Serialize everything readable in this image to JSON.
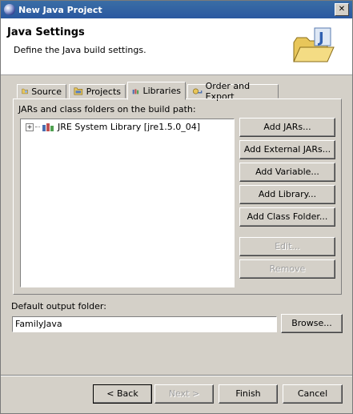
{
  "window": {
    "title": "New Java Project"
  },
  "header": {
    "title": "Java Settings",
    "subtitle": "Define the Java build settings."
  },
  "tabs": [
    {
      "label": "Source",
      "icon": "source-folder-icon",
      "active": false
    },
    {
      "label": "Projects",
      "icon": "projects-icon",
      "active": false
    },
    {
      "label": "Libraries",
      "icon": "libraries-icon",
      "active": true
    },
    {
      "label": "Order and Export",
      "icon": "order-export-icon",
      "active": false
    }
  ],
  "libraries": {
    "build_path_label": "JARs and class folders on the build path:",
    "entries": [
      {
        "label": "JRE System Library [jre1.5.0_04]",
        "icon": "library-icon"
      }
    ],
    "buttons": {
      "add_jars": "Add JARs...",
      "add_external_jars": "Add External JARs...",
      "add_variable": "Add Variable...",
      "add_library": "Add Library...",
      "add_class_folder": "Add Class Folder...",
      "edit": "Edit...",
      "remove": "Remove"
    }
  },
  "output": {
    "label": "Default output folder:",
    "value": "FamilyJava",
    "browse": "Browse..."
  },
  "footer": {
    "back": "< Back",
    "next": "Next >",
    "finish": "Finish",
    "cancel": "Cancel"
  }
}
